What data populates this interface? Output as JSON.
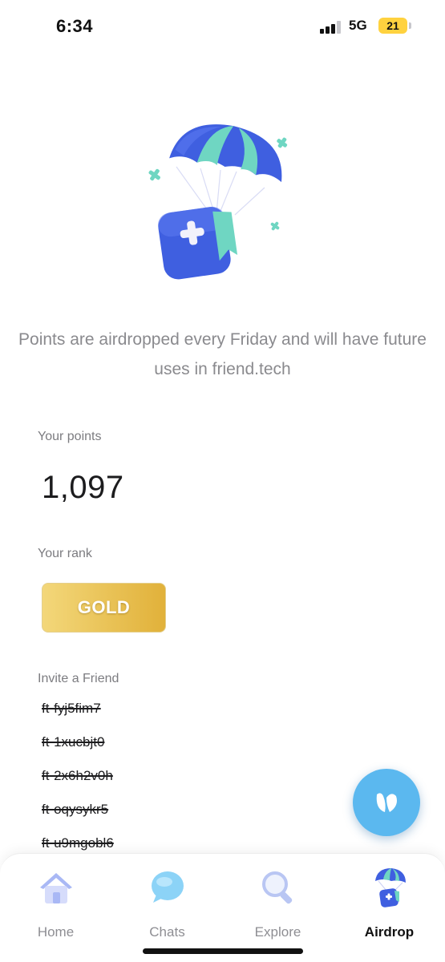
{
  "status_bar": {
    "time": "6:34",
    "network": "5G",
    "battery_level": "21"
  },
  "main": {
    "description": "Points are airdropped every Friday and will have future uses in friend.tech",
    "points": {
      "label": "Your points",
      "value": "1,097"
    },
    "rank": {
      "label": "Your rank",
      "value": "GOLD"
    },
    "invite": {
      "label": "Invite a Friend",
      "codes": [
        "ft-fyj5fim7",
        "ft-1xucbjt0",
        "ft-2x6h2v0h",
        "ft-oqysykr5",
        "ft-u9mgobl6"
      ]
    }
  },
  "fab": {
    "icon": "friendtech-logo-icon"
  },
  "tab_bar": {
    "items": [
      {
        "label": "Home",
        "icon": "home-icon"
      },
      {
        "label": "Chats",
        "icon": "chat-bubble-icon"
      },
      {
        "label": "Explore",
        "icon": "magnifier-icon"
      },
      {
        "label": "Airdrop",
        "icon": "airdrop-parachute-icon"
      }
    ],
    "active": "Airdrop"
  },
  "colors": {
    "accent_blue": "#5bb8ef",
    "gold": "#e9c256",
    "parachute_blue": "#3f5fe0",
    "parachute_teal": "#6fd6c2"
  }
}
